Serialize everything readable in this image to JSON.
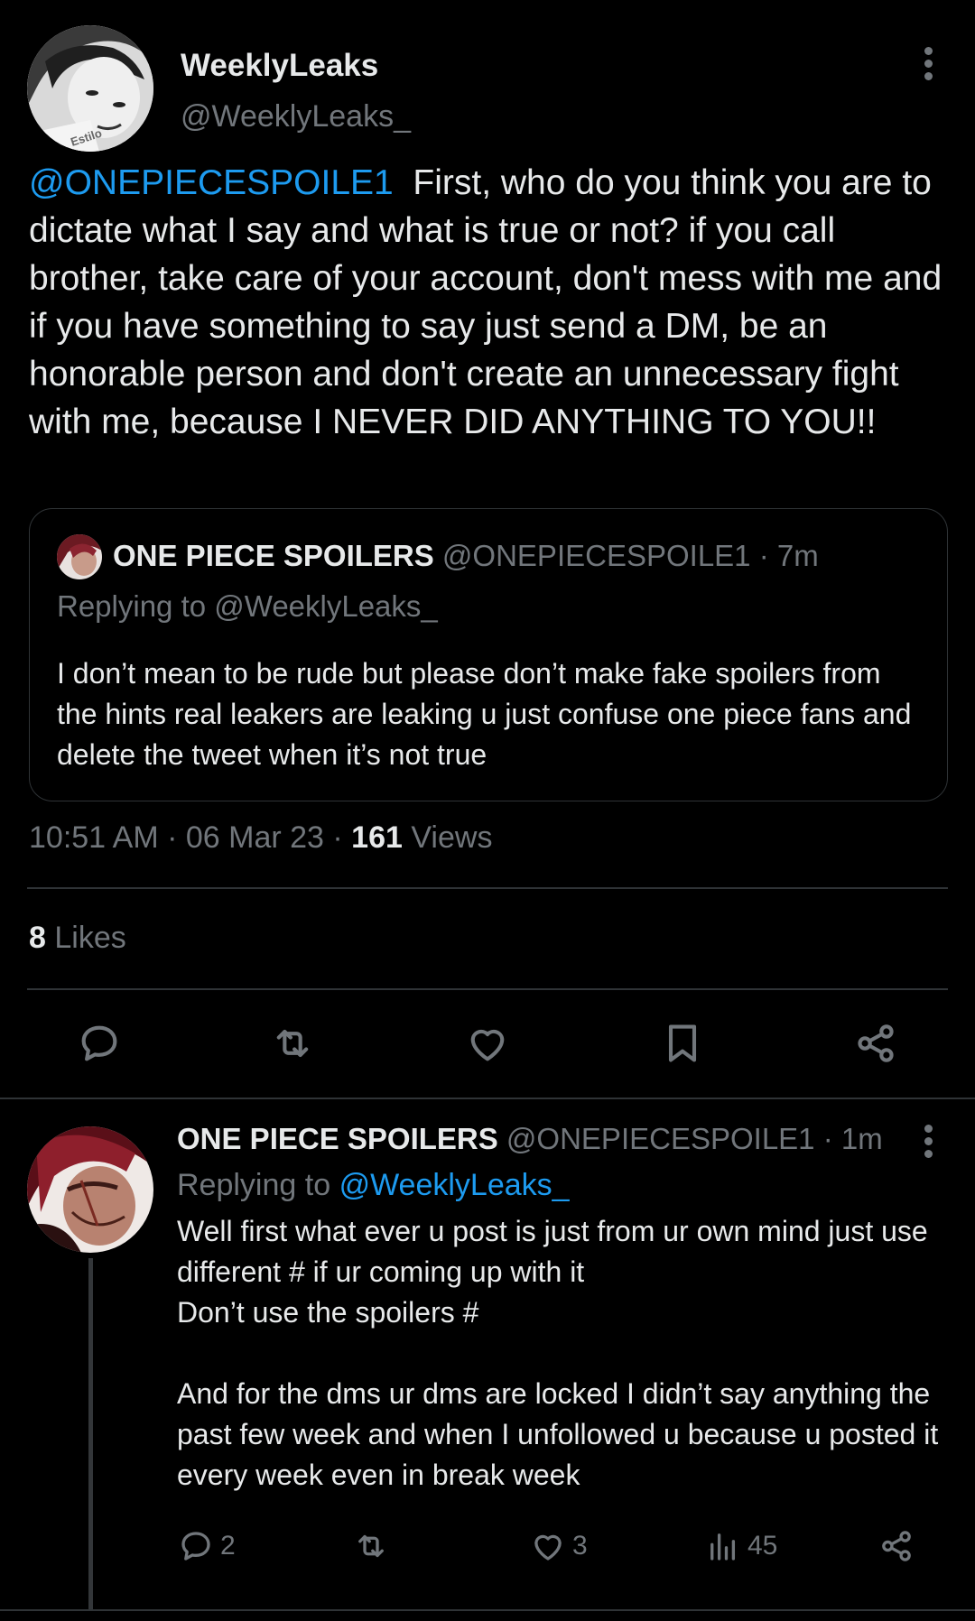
{
  "main_tweet": {
    "display_name": "WeeklyLeaks",
    "handle": "@WeeklyLeaks_",
    "avatar_caption": "Estilo",
    "mention": "@ONEPIECESPOILE1",
    "text": "First, who do you think you are to dictate what I say and what is true or not? if you call brother, take care of your account, don't mess with me and if you have something to say just send a DM, be an honorable person and don't create an unnecessary fight with me, because I NEVER DID ANYTHING TO YOU!!",
    "timestamp": "10:51 AM · 06 Mar 23 · ",
    "views_count": "161",
    "views_label": "Views",
    "likes_count": "8",
    "likes_label": "Likes"
  },
  "quote": {
    "display_name": "ONE PIECE SPOILERS",
    "meta": "@ONEPIECESPOILE1 · 7m",
    "replying_to": "Replying to @WeeklyLeaks_",
    "text": "I don’t mean to be rude but please don’t make fake spoilers from the hints real leakers are leaking u just confuse one piece fans and delete the tweet when it’s not true"
  },
  "reply": {
    "display_name": "ONE PIECE SPOILERS",
    "meta": "@ONEPIECESPOILE1 · 1m",
    "replying_to_prefix": "Replying to",
    "replying_to_handle": "@WeeklyLeaks_",
    "text": "Well first what ever u post is just from ur own mind just use different # if ur coming up with it\nDon’t use the spoilers #\n\nAnd for the dms ur dms are locked I didn’t say anything the past few week and when I unfollowed u because u posted it every week even in break week",
    "reply_count": "2",
    "like_count": "3",
    "view_count": "45"
  },
  "icons": {
    "reply": "reply-bubble-icon",
    "retweet": "retweet-icon",
    "like": "heart-icon",
    "bookmark": "bookmark-icon",
    "share": "share-icon",
    "views": "bar-chart-icon",
    "more": "vertical-dots-icon"
  },
  "colors": {
    "background": "#000000",
    "text": "#e7e9ea",
    "muted": "#71767b",
    "accent": "#1d9bf0",
    "border": "#2f3336"
  }
}
